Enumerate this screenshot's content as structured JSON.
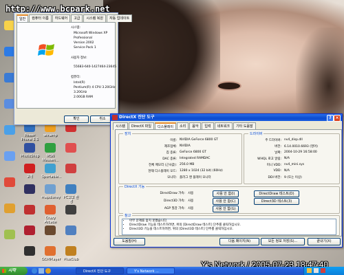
{
  "watermark_top": "http://www.bcpark.net",
  "watermark_bottom": "Y's Network / 2005-07-23 18:47:40",
  "desktop_icons": [
    {
      "label": "",
      "color": "#f7d24a"
    },
    {
      "label": "",
      "color": "#2c7be5"
    },
    {
      "label": "",
      "color": "#3a7bd5"
    },
    {
      "label": "",
      "color": "#5b8de0"
    },
    {
      "label": "",
      "color": "#4aa0e8"
    },
    {
      "label": "",
      "color": "#6aa0f0"
    },
    {
      "label": "",
      "color": "#e04a3a"
    },
    {
      "label": "",
      "color": "#e0a030"
    },
    {
      "label": "",
      "color": "#a0c050"
    }
  ],
  "grid_icons": [
    {
      "label": "Power Phone 3.1",
      "color": "#3070c0"
    },
    {
      "label": "winamp",
      "color": "#f0a020"
    },
    {
      "label": "",
      "color": "#d03030"
    },
    {
      "label": "PhotoShop",
      "color": "#3050a0"
    },
    {
      "label": "MSN Messen...",
      "color": "#30a040"
    },
    {
      "label": "",
      "color": "#e05050"
    },
    {
      "label": "2개",
      "color": "#d02020"
    },
    {
      "label": "Sportable...",
      "color": "#40a0d0"
    },
    {
      "label": "",
      "color": "#d04040"
    },
    {
      "label": "",
      "color": "#303060"
    },
    {
      "label": "mapdisney",
      "color": "#70a0d0"
    },
    {
      "label": "PC고고 환경",
      "color": "#4080c0"
    },
    {
      "label": "",
      "color": "#c03030"
    },
    {
      "label": "Crazy Arcade",
      "color": "#e06030"
    },
    {
      "label": "",
      "color": "#404040"
    },
    {
      "label": "",
      "color": "#b02030"
    },
    {
      "label": "",
      "color": "#6a4a30"
    },
    {
      "label": "",
      "color": "#5080c0"
    },
    {
      "label": "",
      "color": "#303030"
    },
    {
      "label": "GOMPlayer",
      "color": "#e07030"
    },
    {
      "label": "PlusClub",
      "color": "#c08020"
    }
  ],
  "sysprop": {
    "tabs": [
      "일반",
      "컴퓨터 이름",
      "하드웨어",
      "고급",
      "시스템 복원",
      "자동 업데이트"
    ],
    "system_heading": "시스템:",
    "os_lines": [
      "Microsoft Windows XP",
      "Professional",
      "Version 2002",
      "Service Pack 1"
    ],
    "registered_heading": "사용자 정보:",
    "product_id": "55683-640-1427464-23645",
    "computer_heading": "컴퓨터:",
    "computer_lines": [
      "Intel(R)",
      "Pentium(R) 4 CPU 3.20GHz",
      "3.20GHz",
      "2.00GB RAM"
    ],
    "ok": "확인",
    "cancel": "취소"
  },
  "dxdiag": {
    "title": "DirectX 진단 도구",
    "tabs": [
      "시스템",
      "DirectX 파일",
      "디스플레이",
      "소리",
      "음악",
      "입력",
      "네트워크",
      "기타 도움말"
    ],
    "device_group": "장치",
    "device_rows": [
      {
        "label": "이름:",
        "value": "NVIDIA GeForce 6800 GT"
      },
      {
        "label": "제조업체:",
        "value": "NVIDIA"
      },
      {
        "label": "칩 종류:",
        "value": "GeForce 6800 GT"
      },
      {
        "label": "DAC 종류:",
        "value": "Integrated RAMDAC"
      },
      {
        "label": "전체 메모리 (근사값):",
        "value": "256.0 MB"
      },
      {
        "label": "현재 디스플레이 모드:",
        "value": "1280 x 1024 (32 bit) (60Hz)"
      },
      {
        "label": "모니터:",
        "value": "플러그 앤 플레이 모니터"
      }
    ],
    "driver_group": "드라이버",
    "driver_rows": [
      {
        "label": "주 드라이버:",
        "value": "nv4_disp.dll"
      },
      {
        "label": "버전:",
        "value": "6.14.0010.6693 (영어)"
      },
      {
        "label": "날짜:",
        "value": "2004-10-29 16:58:00"
      },
      {
        "label": "WHQL 로고 알림:",
        "value": "N/A"
      },
      {
        "label": "미니 VDD:",
        "value": "nv4_mini.sys"
      },
      {
        "label": "VDD:",
        "value": "N/A"
      },
      {
        "label": "DDI 버전:",
        "value": "9 (또는 이상)"
      }
    ],
    "features_group": "DirectX 기능",
    "features": [
      {
        "label": "DirectDraw 가속:",
        "status": "사용",
        "button": "사용 안 함(I)",
        "test": "DirectDraw 테스트(D)"
      },
      {
        "label": "Direct3D 가속:",
        "status": "사용",
        "button": "사용 안 함(C)",
        "test": "Direct3D 테스트(3)"
      },
      {
        "label": "AGP 질감 가속:",
        "status": "사용",
        "button": "사용 안 함(G)",
        "test": ""
      }
    ],
    "notes_group": "참고",
    "notes": [
      "아무 문제를 찾지 못했습니다.",
      "DirectDraw 기능을 테스트하려면, 위의 [DirectDraw 테스트] 단추를 클릭하십시오.",
      "Direct3D 기능을 테스트하려면, 위의 [Direct3D 테스트] 단추를 클릭하십시오."
    ],
    "help_btn": "도움말(H)",
    "next_btn": "다음 페이지(N)",
    "save_btn": "모든 정보 저장(S)...",
    "exit_btn": "끝내기(X)"
  },
  "taskbar": {
    "start": "시작",
    "tasks": [
      "DirectX 진단 도구",
      "Y's Network ..."
    ]
  }
}
